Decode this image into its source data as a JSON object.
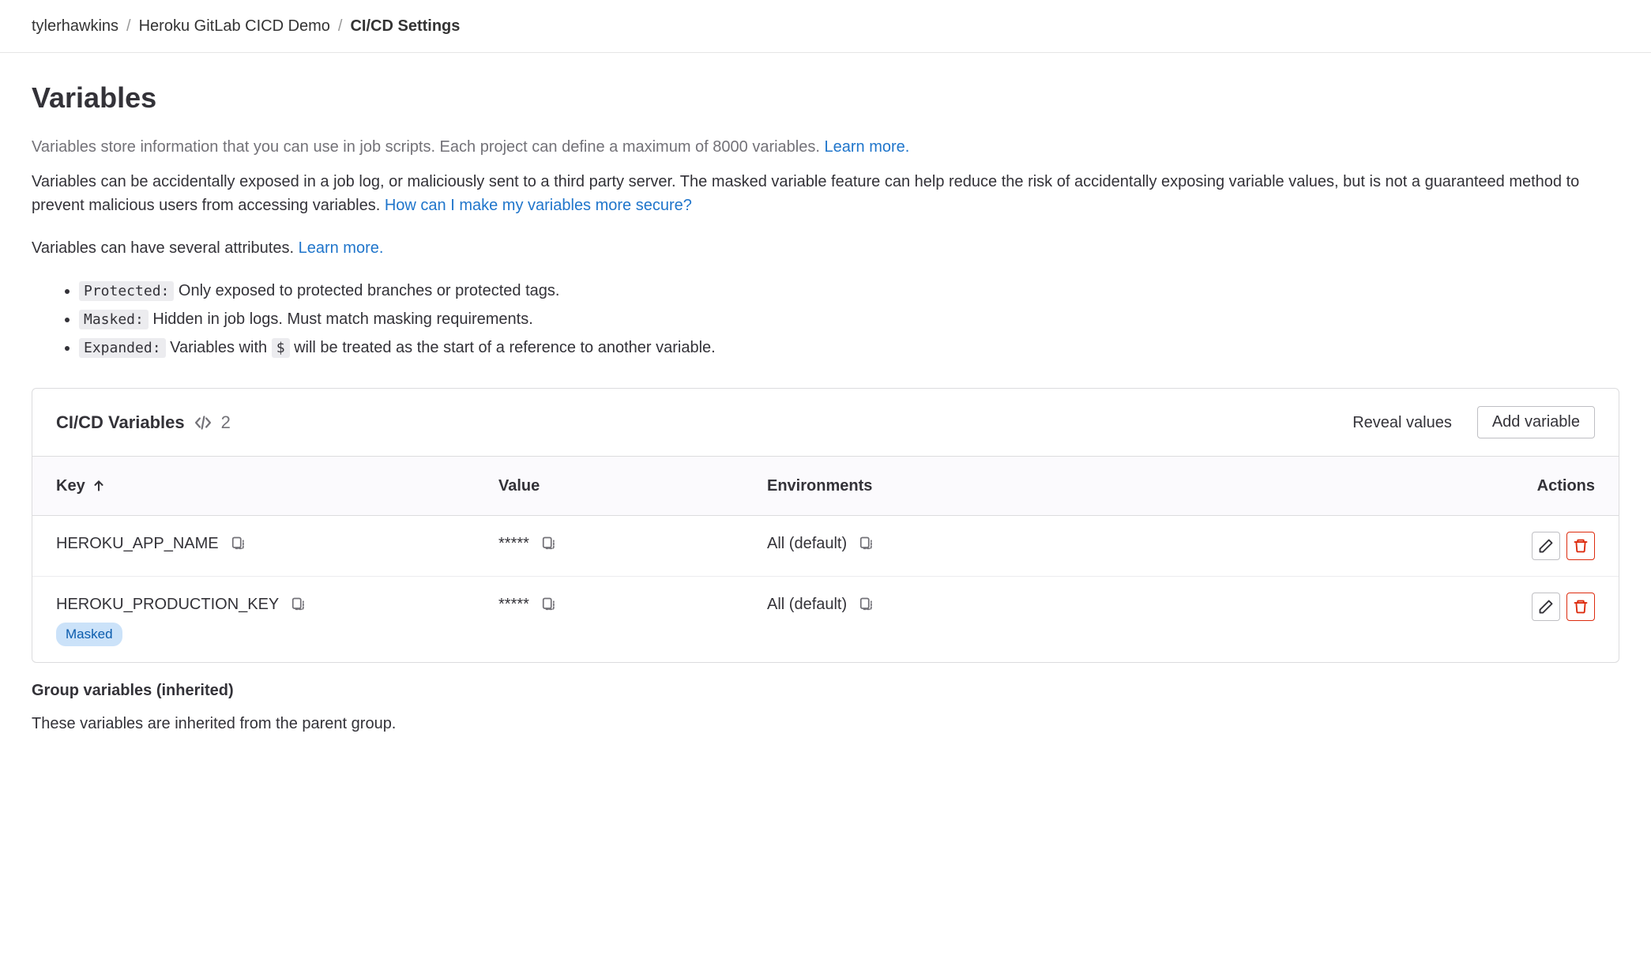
{
  "breadcrumb": {
    "items": [
      "tylerhawkins",
      "Heroku GitLab CICD Demo",
      "CI/CD Settings"
    ]
  },
  "title": "Variables",
  "desc1_pre": "Variables store information that you can use in job scripts. Each project can define a maximum of 8000 variables. ",
  "desc1_link": "Learn more.",
  "desc2_pre": "Variables can be accidentally exposed in a job log, or maliciously sent to a third party server. The masked variable feature can help reduce the risk of accidentally exposing variable values, but is not a guaranteed method to prevent malicious users from accessing variables. ",
  "desc2_link": "How can I make my variables more secure?",
  "desc3_pre": "Variables can have several attributes. ",
  "desc3_link": "Learn more.",
  "attrs": [
    {
      "tag": "Protected:",
      "text": " Only exposed to protected branches or protected tags."
    },
    {
      "tag": "Masked:",
      "text": " Hidden in job logs. Must match masking requirements."
    },
    {
      "tag": "Expanded:",
      "pre": " Variables with ",
      "code": "$",
      "post": " will be treated as the start of a reference to another variable."
    }
  ],
  "panel": {
    "title": "CI/CD Variables",
    "count": "2",
    "reveal": "Reveal values",
    "add": "Add variable",
    "columns": {
      "key": "Key",
      "value": "Value",
      "env": "Environments",
      "actions": "Actions"
    },
    "rows": [
      {
        "key": "HEROKU_APP_NAME",
        "value": "*****",
        "env": "All (default)",
        "badges": []
      },
      {
        "key": "HEROKU_PRODUCTION_KEY",
        "value": "*****",
        "env": "All (default)",
        "badges": [
          "Masked"
        ]
      }
    ]
  },
  "footer": {
    "title": "Group variables (inherited)",
    "text": "These variables are inherited from the parent group."
  }
}
